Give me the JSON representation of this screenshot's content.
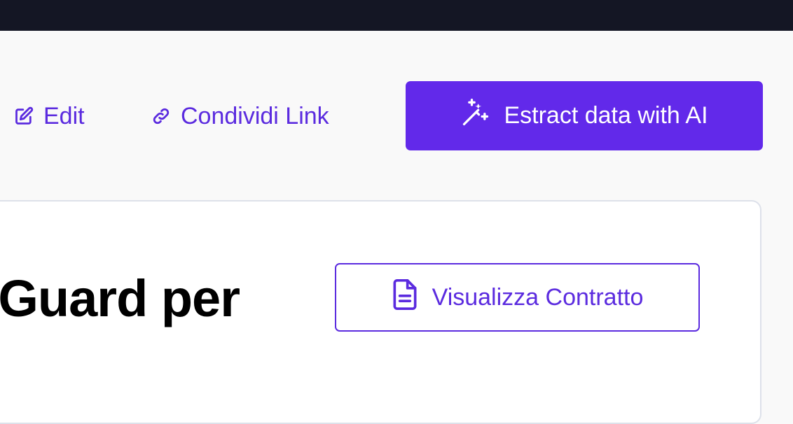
{
  "toolbar": {
    "edit_label": "Edit",
    "share_label": "Condividi Link",
    "extract_label": "Estract data with AI"
  },
  "card": {
    "title_fragment": "Guard per",
    "view_contract_label": "Visualizza Contratto"
  },
  "colors": {
    "accent": "#6229ea",
    "accent_text": "#5b2bdf",
    "topbar": "#141624",
    "page_bg": "#f9f9f9"
  },
  "icons": {
    "edit": "pencil-square-icon",
    "share": "link-icon",
    "extract": "magic-wand-sparkles-icon",
    "view_contract": "document-text-icon"
  }
}
